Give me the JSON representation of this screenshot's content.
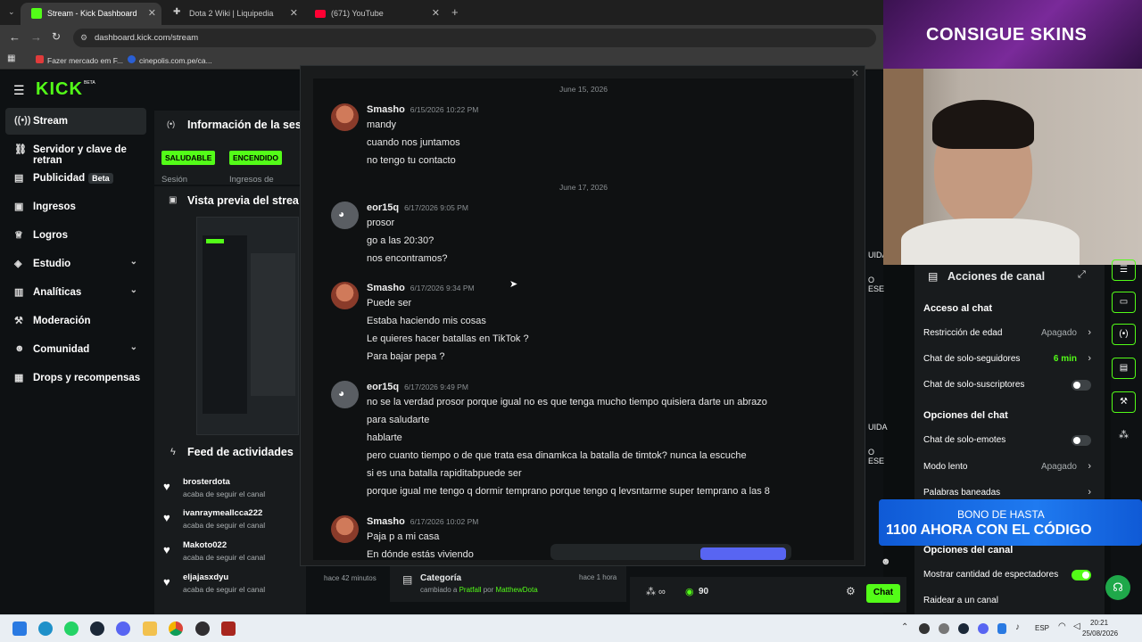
{
  "browser": {
    "tabs": [
      {
        "label": "Stream - Kick Dashboard",
        "active": true
      },
      {
        "label": "Dota 2 Wiki | Liquipedia",
        "active": false
      },
      {
        "label": "(671) YouTube",
        "active": false
      }
    ],
    "url": "dashboard.kick.com/stream",
    "bookmarks": [
      "Fazer mercado em F...",
      "cinepolis.com.pe/ca..."
    ]
  },
  "sidebar": {
    "logo": "KICK",
    "logo_sup": "BETA",
    "items": [
      {
        "label": "Stream",
        "icon": "broadcast-icon"
      },
      {
        "label": "Servidor y clave de retran",
        "icon": "link-icon"
      },
      {
        "label": "Publicidad",
        "badge": "Beta",
        "icon": "ad-icon"
      },
      {
        "label": "Ingresos",
        "icon": "wallet-icon"
      },
      {
        "label": "Logros",
        "icon": "trophy-icon"
      },
      {
        "label": "Estudio",
        "icon": "palette-icon"
      },
      {
        "label": "Analíticas",
        "icon": "chart-icon"
      },
      {
        "label": "Moderación",
        "icon": "hammer-icon"
      },
      {
        "label": "Comunidad",
        "icon": "people-icon"
      },
      {
        "label": "Drops y recompensas",
        "icon": "gift-icon"
      }
    ]
  },
  "session": {
    "title": "Información de la ses",
    "badge1": "SALUDABLE",
    "badge2": "ENCENDIDO",
    "label1": "Sesión",
    "label2": "Ingresos de"
  },
  "preview": {
    "title": "Vista previa del strea"
  },
  "feed": {
    "title": "Feed de actividades",
    "items": [
      {
        "name": "brosterdota",
        "action": "acaba de seguir el canal"
      },
      {
        "name": "ivanraymeallcca222",
        "action": "acaba de seguir el canal"
      },
      {
        "name": "Makoto022",
        "action": "acaba de seguir el canal"
      },
      {
        "name": "eljajasxdyu",
        "action": "acaba de seguir el canal",
        "time": "hace 42 minutos"
      }
    ]
  },
  "category_event": {
    "title": "Categoría",
    "detail_prefix": "cambiado a",
    "new": "Pratfall",
    "by": "por",
    "user": "MatthewDota",
    "time": "hace 1 hora"
  },
  "bottom_bar": {
    "viewers": "90",
    "chat_button": "Chat"
  },
  "chat": {
    "dates": [
      "June 15, 2026",
      "June 17, 2026"
    ],
    "messages": [
      {
        "author": "Smasho",
        "time": "6/15/2026 10:22 PM",
        "avatar": "smasho",
        "lines": [
          "mandy",
          "cuando nos juntamos",
          "no tengo tu contacto"
        ]
      },
      {
        "author": "eor15q",
        "time": "6/17/2026 9:05 PM",
        "avatar": "discord",
        "lines": [
          "prosor",
          "go a las 20:30?",
          "nos encontramos?"
        ]
      },
      {
        "author": "Smasho",
        "time": "6/17/2026 9:34 PM",
        "avatar": "smasho",
        "lines": [
          "Puede ser",
          "Estaba haciendo mis cosas",
          "Le quieres hacer batallas en TikTok ?",
          "Para bajar pepa ?"
        ]
      },
      {
        "author": "eor15q",
        "time": "6/17/2026 9:49 PM",
        "avatar": "discord",
        "lines": [
          "no se la verdad prosor porque igual no es que tenga mucho tiempo quisiera darte un abrazo",
          "para saludarte",
          "hablarte",
          "pero cuanto tiempo o de que trata esa dinamkca la batalla de timtok? nunca la escuche",
          "si es una batalla rapiditabpuede ser",
          "porque igual me tengo q dormir temprano porque tengo q levsntarme super temprano a las 8"
        ]
      },
      {
        "author": "Smasho",
        "time": "6/17/2026 10:02 PM",
        "avatar": "smasho",
        "lines": [
          "Paja p a mi casa",
          "En dónde estás viviendo"
        ]
      }
    ]
  },
  "right_mid": {
    "r1": "UIDA",
    "r2": "O ESE",
    "r3": "UIDA",
    "r4": "O ESE"
  },
  "overlay_banner": {
    "top": "CONSIGUE SKINS",
    "bono1": "BONO DE HASTA",
    "bono2": "1100 AHORA CON EL CÓDIGO"
  },
  "actions": {
    "title": "Acciones de canal",
    "acceso": "Acceso al chat",
    "rows_acceso": [
      {
        "label": "Restricción de edad",
        "value": "Apagado"
      },
      {
        "label": "Chat de solo-seguidores",
        "value": "6 min"
      },
      {
        "label": "Chat de solo-suscriptores"
      }
    ],
    "opciones_chat": "Opciones del chat",
    "rows_chat": [
      {
        "label": "Chat de solo-emotes"
      },
      {
        "label": "Modo lento",
        "value": "Apagado"
      },
      {
        "label": "Palabras baneadas"
      }
    ],
    "opciones_canal": "Opciones del canal",
    "rows_canal": [
      {
        "label": "Mostrar cantidad de espectadores"
      },
      {
        "label": "Raidear a un canal"
      }
    ]
  },
  "taskbar": {
    "lang": "ESP",
    "time": "20:21",
    "date": "25/08/2026"
  }
}
